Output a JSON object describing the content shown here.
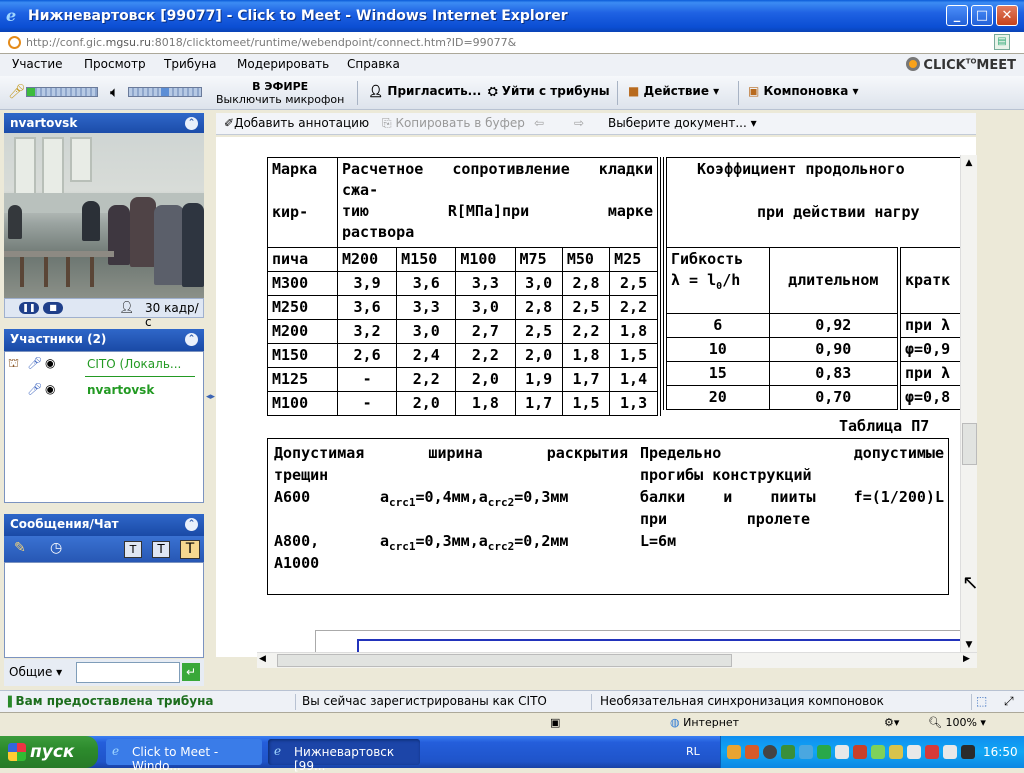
{
  "window": {
    "title": "Нижневартовск [99077] - Click to Meet - Windows Internet Explorer",
    "url_prefix": "http://conf.gic.",
    "url_host": "mgsu.ru",
    "url_rest": ":8018/clicktomeet/runtime/webendpoint/connect.htm?ID=99077&"
  },
  "menu": {
    "items": [
      "Участие",
      "Просмотр",
      "Трибуна",
      "Модерировать",
      "Справка"
    ],
    "logo": "CLICK",
    "logo_sup": "TO",
    "logo_end": "MEET"
  },
  "toolbar": {
    "onair_line1": "В ЭФИРЕ",
    "onair_line2": "Выключить микрофон",
    "invite": "Пригласить...",
    "leave": "Уйти с трибуны",
    "action": "Действие",
    "layout": "Компоновка"
  },
  "video_panel": {
    "title": "nvartovsk",
    "fps_value": "30",
    "fps_label": "кадр/с"
  },
  "participants": {
    "title": "Участники (2)",
    "items": [
      {
        "name": "CITO (Локаль..."
      },
      {
        "name": "nvartovsk"
      }
    ]
  },
  "chat": {
    "title": "Сообщения/Чат",
    "scope": "Общие"
  },
  "doc_toolbar": {
    "add_annotation": "Добавить аннотацию",
    "copy": "Копировать в буфер",
    "select_doc": "Выберите документ..."
  },
  "document": {
    "table1": {
      "h_marka": "Марка",
      "h_kir": "кир-",
      "h_picha": "пича",
      "h_resist": "Расчетное сопротивление кладки сжа-",
      "h_resist2_a": "тию",
      "h_resist2_b": "R[МПа]при",
      "h_resist2_c": "марке",
      "h_resist3": "раствора",
      "grades": [
        "М200",
        "М150",
        "М100",
        "М75",
        "М50",
        "М25"
      ],
      "rows": [
        {
          "brick": "М300",
          "values": [
            "3,9",
            "3,6",
            "3,3",
            "3,0",
            "2,8",
            "2,5"
          ]
        },
        {
          "brick": "М250",
          "values": [
            "3,6",
            "3,3",
            "3,0",
            "2,8",
            "2,5",
            "2,2"
          ]
        },
        {
          "brick": "М200",
          "values": [
            "3,2",
            "3,0",
            "2,7",
            "2,5",
            "2,2",
            "1,8"
          ]
        },
        {
          "brick": "М150",
          "values": [
            "2,6",
            "2,4",
            "2,2",
            "2,0",
            "1,8",
            "1,5"
          ]
        },
        {
          "brick": "М125",
          "values": [
            "-",
            "2,2",
            "2,0",
            "1,9",
            "1,7",
            "1,4"
          ]
        },
        {
          "brick": "М100",
          "values": [
            "-",
            "2,0",
            "1,8",
            "1,7",
            "1,5",
            "1,3"
          ]
        }
      ]
    },
    "table2": {
      "h_coef": "Коэффициент продольного",
      "h_action": "при действии нагру",
      "h_flex": "Гибкость",
      "h_lambda": "λ = l",
      "h_sub": "0",
      "h_h": "/h",
      "h_long": "длительном",
      "h_short": "кратк",
      "rows": [
        {
          "flex": "6",
          "long": "0,92"
        },
        {
          "flex": "10",
          "long": "0,90"
        },
        {
          "flex": "15",
          "long": "0,83"
        },
        {
          "flex": "20",
          "long": "0,70"
        }
      ],
      "short_text": [
        "при λ",
        "φ=0,9",
        "при λ",
        "φ=0,8"
      ]
    },
    "table_caption": "Таблица П7",
    "cracks": {
      "title_a": "Допустимая",
      "title_b": "ширина",
      "title_c": "раскрытия",
      "title2": "трещин",
      "row1_label": "А600",
      "row1_a": "a",
      "row1_sub1": "crc1",
      "row1_mid": "=0,4мм,a",
      "row1_sub2": "crc2",
      "row1_end": "=0,3мм",
      "row2_label1": "А800,",
      "row2_label2": "А1000",
      "row2_a": "a",
      "row2_sub1": "crc1",
      "row2_mid": "=0,3мм,a",
      "row2_sub2": "crc2",
      "row2_end": "=0,2мм"
    },
    "deflect": {
      "l1a": "Предельно",
      "l1b": "допустимые",
      "l2": "прогибы конструкций",
      "l3a": "балки",
      "l3b": "и",
      "l3c": "пииты",
      "l3d": "f=(1/200)L",
      "l4a": "при",
      "l4b": "пролете",
      "l5": "L=6м"
    }
  },
  "app_status": {
    "tribune": "Вам предоставлена трибуна",
    "registered": "Вы сейчас зарегистрированы как CITO",
    "sync": "Необязательная синхронизация компоновок"
  },
  "ie_status": {
    "zone": "Интернет",
    "zoom": "100%"
  },
  "taskbar": {
    "start": "пуск",
    "tasks": [
      "Click to Meet - Windo...",
      "Нижневартовск [99..."
    ],
    "lang": "RL",
    "time": "16:50"
  }
}
